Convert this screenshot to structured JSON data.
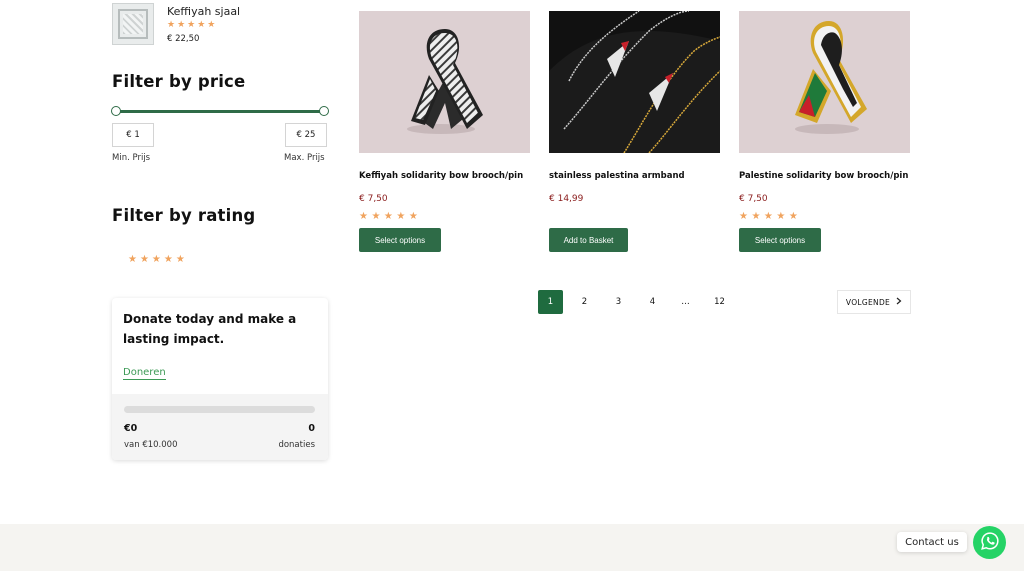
{
  "sidebar": {
    "top_product": {
      "name": "Keffiyah sjaal",
      "stars": "★★★★★",
      "price": "€ 22,50"
    },
    "price_filter": {
      "title": "Filter by price",
      "min_value": "€ 1",
      "max_value": "€ 25",
      "min_label": "Min. Prijs",
      "max_label": "Max. Prijs"
    },
    "rating_filter": {
      "title": "Filter by rating",
      "stars": "★★★★★"
    },
    "donate": {
      "title": "Donate today and make a lasting impact.",
      "link": "Doneren",
      "raised": "€0",
      "goal": "van €10.000",
      "count": "0",
      "count_label": "donaties",
      "progress_fraction": 0
    }
  },
  "products": [
    {
      "name": "Keffiyah solidarity bow brooch/pin",
      "price": "€ 7,50",
      "stars": "★★★★★",
      "button": "Select options"
    },
    {
      "name": "stainless palestina armband",
      "price": "€ 14,99",
      "stars": "",
      "button": "Add to Basket"
    },
    {
      "name": "Palestine solidarity bow brooch/pin",
      "price": "€ 7,50",
      "stars": "★★★★★",
      "button": "Select options"
    }
  ],
  "pagination": {
    "pages": [
      "1",
      "2",
      "3",
      "4",
      "…",
      "12"
    ],
    "active": "1",
    "next_label": "VOLGENDE"
  },
  "contact": {
    "label": "Contact us",
    "icon": "whatsapp-icon"
  },
  "colors": {
    "brand_green": "#2e6b47",
    "price_red": "#8a1c1c",
    "star": "#f0a35e",
    "whatsapp": "#25d366"
  }
}
